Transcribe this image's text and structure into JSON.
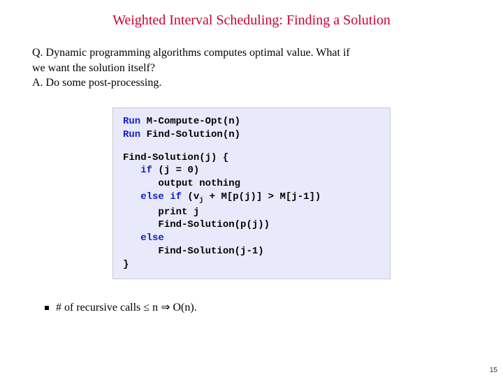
{
  "title": "Weighted Interval Scheduling:  Finding a Solution",
  "q_line1": "Q.  Dynamic programming algorithms computes optimal value.  What if",
  "q_line2": "we want the solution itself?",
  "a_line": "A.  Do some post-processing.",
  "code": {
    "kw_run1": "Run",
    "run1_rest": " M-Compute-Opt(n)",
    "kw_run2": "Run",
    "run2_rest": " Find-Solution(n)",
    "fn_sig": "Find-Solution(j) {",
    "kw_if": "if",
    "if_cond": " (j = 0)",
    "out_nothing": "output nothing",
    "kw_elseif1": "else if",
    "elseif_open": " (v",
    "elseif_sub": "j",
    "elseif_rest": " + M[p(j)] > M[j-1])",
    "print_j": "print j",
    "rec1": "Find-Solution(p(j))",
    "kw_else": "else",
    "rec2": "Find-Solution(j-1)",
    "close": "}"
  },
  "bullet": "# of recursive calls ≤ n  ⇒  O(n).",
  "pagenum": "15"
}
